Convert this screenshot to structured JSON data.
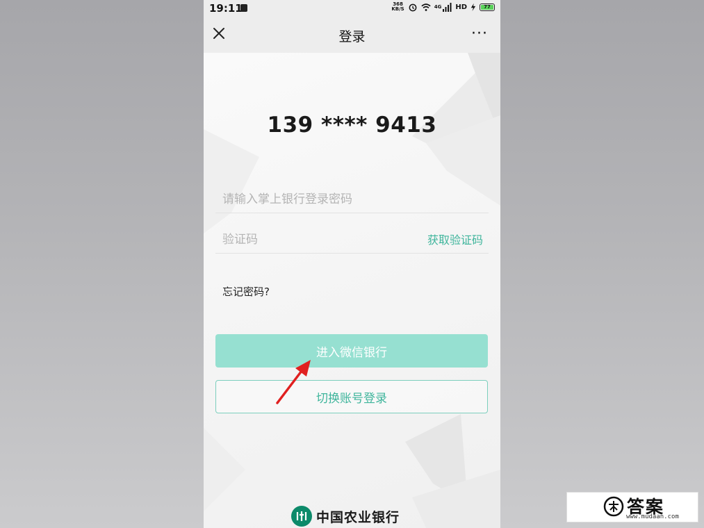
{
  "status_bar": {
    "time": "19:11",
    "net_speed_top": "368",
    "net_speed_bottom": "KB/S",
    "network_label": "4G",
    "hd_label": "HD",
    "battery": "77"
  },
  "nav": {
    "title": "登录",
    "close_icon": "close-icon",
    "more_icon": "more-icon",
    "more_label": "···"
  },
  "login": {
    "phone_number": "139 **** 9413",
    "password_placeholder": "请输入掌上银行登录密码",
    "code_placeholder": "验证码",
    "get_code_label": "获取验证码",
    "forgot_label": "忘记密码?",
    "enter_button": "进入微信银行",
    "switch_button": "切换账号登录"
  },
  "footer": {
    "bank_name": "中国农业银行"
  },
  "watermark": {
    "title": "答案",
    "url": "www.mudaan.com"
  },
  "colors": {
    "accent": "#3fb59c",
    "button_disabled": "#96e0d1",
    "arrow": "#e02020"
  }
}
